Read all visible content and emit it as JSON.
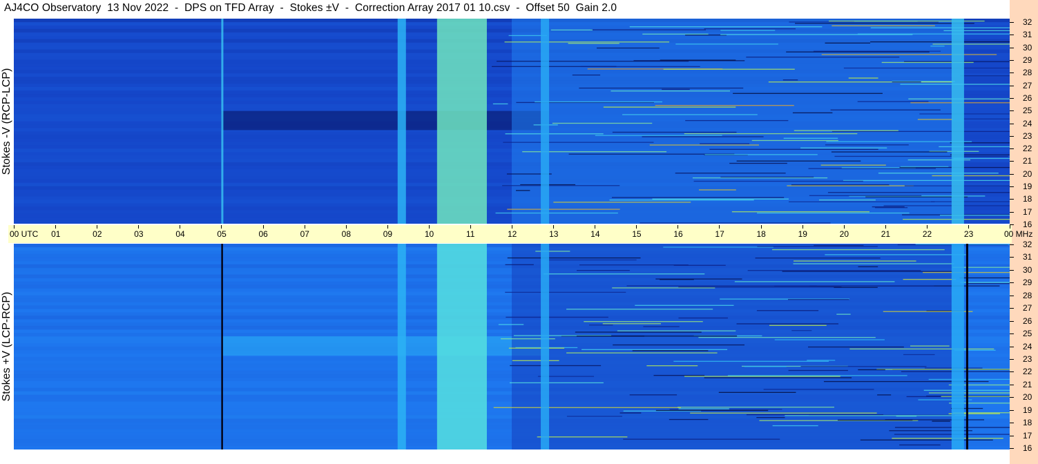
{
  "title": "AJ4CO Observatory  13 Nov 2022  -  DPS on TFD Array  -  Stokes ±V  -  Correction Array 2017 01 10.csv  -  Offset 50  Gain 2.0",
  "chart_data": {
    "type": "heatmap",
    "x_unit": "UTC",
    "y_unit": "MHz",
    "xlim": [
      0,
      24
    ],
    "ylim": [
      16,
      32
    ],
    "x_tick_labels": [
      "00 UTC",
      "01",
      "02",
      "03",
      "04",
      "05",
      "06",
      "07",
      "08",
      "09",
      "10",
      "11",
      "12",
      "13",
      "14",
      "15",
      "16",
      "17",
      "18",
      "19",
      "20",
      "21",
      "22",
      "23",
      "00 MHz"
    ],
    "y_tick_labels": [
      "16",
      "17",
      "18",
      "19",
      "20",
      "21",
      "22",
      "23",
      "24",
      "25",
      "26",
      "27",
      "28",
      "29",
      "30",
      "31",
      "32"
    ],
    "panels": [
      {
        "id": "top",
        "ylabel": "Stokes -V (RCP-LCP)",
        "polarity": -1,
        "background_level": 0.3,
        "bands": [
          {
            "t0": 5.0,
            "t1": 5.05,
            "level": 0.62
          },
          {
            "t0": 9.25,
            "t1": 9.45,
            "level": 0.58
          },
          {
            "t0": 10.2,
            "t1": 11.4,
            "level": 0.75
          },
          {
            "t0": 12.7,
            "t1": 12.9,
            "level": 0.55
          },
          {
            "t0": 22.6,
            "t1": 22.9,
            "level": 0.62
          }
        ],
        "dark_band_freq": [
          23.3,
          24.8
        ]
      },
      {
        "id": "bottom",
        "ylabel": "Stokes +V (LCP-RCP)",
        "polarity": 1,
        "background_level": 0.42,
        "bands": [
          {
            "t0": 5.0,
            "t1": 5.04,
            "level": 0.0
          },
          {
            "t0": 9.25,
            "t1": 9.45,
            "level": 0.58
          },
          {
            "t0": 10.2,
            "t1": 11.4,
            "level": 0.72
          },
          {
            "t0": 12.7,
            "t1": 12.9,
            "level": 0.55
          },
          {
            "t0": 22.6,
            "t1": 22.9,
            "level": 0.55
          },
          {
            "t0": 22.95,
            "t1": 23.0,
            "level": 0.0
          }
        ],
        "bright_band_freq": [
          23.3,
          24.8
        ]
      }
    ],
    "colormap": [
      "#000010",
      "#0a1a78",
      "#1545c8",
      "#1f78f0",
      "#2ab0f5",
      "#50e0e8",
      "#c8f040",
      "#ff3020"
    ]
  }
}
